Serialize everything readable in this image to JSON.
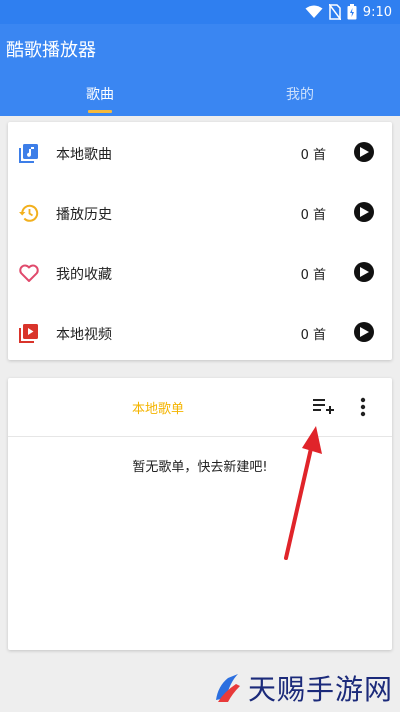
{
  "status_bar": {
    "time": "9:10"
  },
  "app": {
    "title": "酷歌播放器"
  },
  "tabs": [
    {
      "label": "歌曲",
      "active": true
    },
    {
      "label": "我的",
      "active": false
    }
  ],
  "library": {
    "items": [
      {
        "label": "本地歌曲",
        "count": "0 首",
        "icon": "music-library-icon"
      },
      {
        "label": "播放历史",
        "count": "0 首",
        "icon": "history-icon"
      },
      {
        "label": "我的收藏",
        "count": "0 首",
        "icon": "heart-icon"
      },
      {
        "label": "本地视频",
        "count": "0 首",
        "icon": "video-library-icon"
      }
    ]
  },
  "playlist": {
    "title": "本地歌单",
    "empty_text": "暂无歌单，快去新建吧!"
  },
  "watermark": {
    "text": "天赐手游网"
  },
  "colors": {
    "primary": "#3a86f2",
    "accent": "#f6b93b",
    "playlist_title": "#f4b400",
    "blue_icon": "#3d7ee8",
    "orange_icon": "#f2b01e",
    "pink_icon": "#e04a6c",
    "red_icon": "#d9342b",
    "arrow": "#e0242a"
  }
}
